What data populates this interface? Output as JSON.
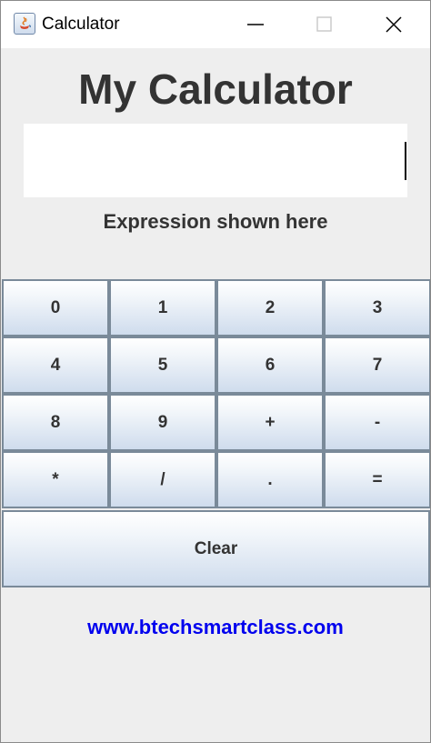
{
  "window": {
    "title": "Calculator"
  },
  "heading": "My Calculator",
  "display": {
    "value": ""
  },
  "expression_label": "Expression shown here",
  "keypad": {
    "keys": [
      "0",
      "1",
      "2",
      "3",
      "4",
      "5",
      "6",
      "7",
      "8",
      "9",
      "+",
      "-",
      "*",
      "/",
      ".",
      "="
    ],
    "clear_label": "Clear"
  },
  "footer": {
    "link_text": "www.btechsmartclass.com"
  },
  "colors": {
    "background": "#eeeeee",
    "text": "#333333",
    "link": "#0000ee",
    "button_border": "#7a8a99"
  },
  "icons": [
    "java-app-icon",
    "minimize-icon",
    "maximize-icon",
    "close-icon"
  ]
}
